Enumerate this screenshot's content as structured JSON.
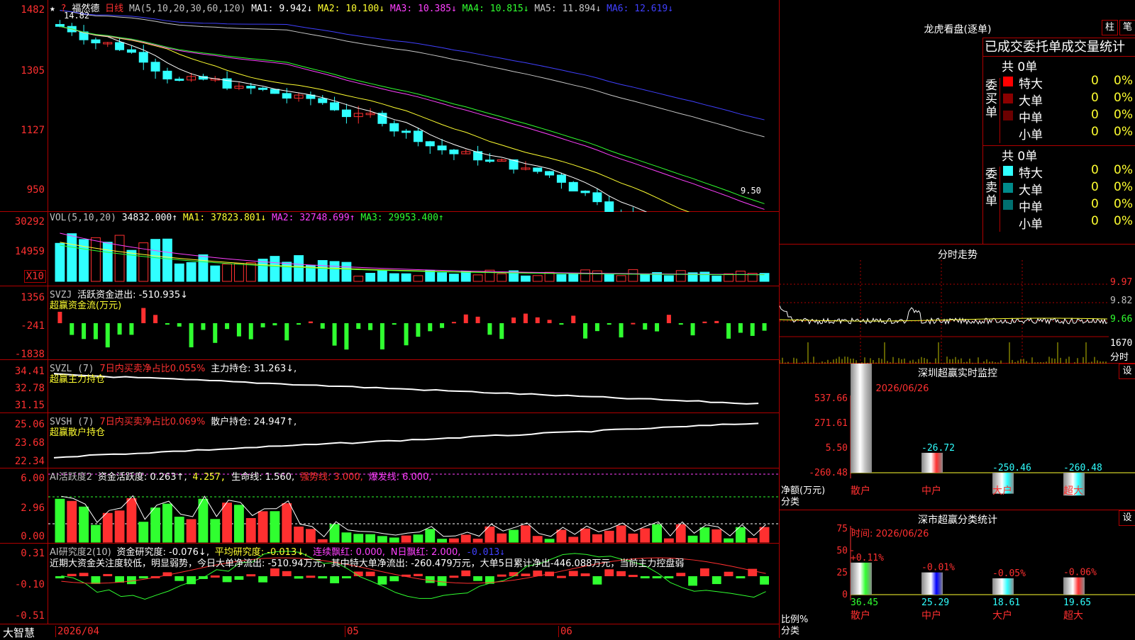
{
  "colors": {
    "up": "#ff3030",
    "down": "#30ffff",
    "grid": "#b00000"
  },
  "main_chart": {
    "stock_name": "福然德",
    "period": "日线",
    "ma_label": "MA(5,10,20,30,60,120)",
    "ma1": "MA1: 9.942↓",
    "ma2": "MA2: 10.100↓",
    "ma3": "MA3: 10.385↓",
    "ma4": "MA4: 10.815↓",
    "ma5": "MA5: 11.894↓",
    "ma6": "MA6: 12.619↓",
    "high_mark": "14.82",
    "low_mark": "9.50",
    "y_ticks": [
      "1482",
      "1305",
      "1127",
      "950"
    ],
    "star": "★",
    "question": "?"
  },
  "volume": {
    "label": "VOL(5,10,20)",
    "value": "34832.000↑",
    "ma1": "MA1: 37823.801↓",
    "ma2": "MA2: 32748.699↑",
    "ma3": "MA3: 29953.400↑",
    "y_ticks": [
      "30292",
      "14959"
    ],
    "unit": "X10"
  },
  "svzj": {
    "label": "SVZJ",
    "title": "活跃资金进出: -510.935↓",
    "subtitle": "超赢资金流(万元)",
    "y_ticks": [
      "1356",
      "-241",
      "-1838"
    ]
  },
  "svzl": {
    "label": "SVZL (7)",
    "ratio": "7日内买卖净占比0.055%",
    "hold": "主力持仓: 31.263↓,",
    "subtitle": "超赢主力持仓",
    "y_ticks": [
      "34.41",
      "32.78",
      "31.15"
    ]
  },
  "svsh": {
    "label": "SVSH (7)",
    "ratio": "7日内买卖净占比0.069%",
    "hold": "散户持仓: 24.947↑,",
    "subtitle": "超赢散户持仓",
    "y_ticks": [
      "25.06",
      "23.68",
      "22.34"
    ]
  },
  "ai_active": {
    "label": "AI活跃度2",
    "v1": "资金活跃度: 0.263↑,",
    "v2": "4.257,",
    "v3": "生命线: 1.560,",
    "v4": "强势线: 3.000,",
    "v5": "爆发线: 6.000,",
    "y_ticks": [
      "6.00",
      "2.96",
      "0.00"
    ]
  },
  "ai_research": {
    "label": "AI研究度2(10)",
    "v1": "资金研究度: -0.076↓,",
    "v2": "平均研究度: -0.013↓,",
    "v3": "连续飘红: 0.000,",
    "v4": "N日飘红: 2.000,",
    "v5": "-0.013↓",
    "comment": "近期大资金关注度较低，明显弱势，今日大单净流出: -510.94万元，其中特大单净流出: -260.479万元，大单5日累计净出-446.088万元，当前主力控盘弱",
    "y_ticks": [
      "0.31",
      "-0.10",
      "-0.51"
    ]
  },
  "bottom": {
    "brand": "大智慧",
    "dates": [
      "2026/04",
      "05",
      "06"
    ]
  },
  "dragon": {
    "title": "龙虎看盘(逐单)",
    "btn_bar": "柱",
    "btn_pen": "笔",
    "tabs": "已成交委托单成交量统计",
    "buy_label": "委买单",
    "sell_label": "委卖单",
    "buy_total": "共 0单",
    "sell_total": "共 0单",
    "rows": [
      {
        "name": "特大",
        "count": "0",
        "pct": "0%"
      },
      {
        "name": "大单",
        "count": "0",
        "pct": "0%"
      },
      {
        "name": "中单",
        "count": "0",
        "pct": "0%"
      },
      {
        "name": "小单",
        "count": "0",
        "pct": "0%"
      }
    ]
  },
  "intraday": {
    "title": "分时走势",
    "prices": [
      "9.97",
      "9.82",
      "9.66"
    ],
    "vol": "1670",
    "vol_label": "分时"
  },
  "sz_monitor": {
    "title": "深圳超赢实时监控",
    "btn": "设",
    "time": "时间: 2026/06/26",
    "y_ticks": [
      "537.66",
      "271.61",
      "5.50",
      "-260.48"
    ],
    "ylabel1": "净额(万元)",
    "ylabel2": "分类",
    "bars": [
      {
        "cat": "散户",
        "value": 537.66,
        "label": "537.66"
      },
      {
        "cat": "中户",
        "value": -26.72,
        "label": "-26.72"
      },
      {
        "cat": "大户",
        "value": -250.46,
        "label": "-250.46"
      },
      {
        "cat": "超大",
        "value": -260.48,
        "label": "-260.48"
      }
    ]
  },
  "sz_class": {
    "title": "深市超赢分类统计",
    "btn": "设",
    "time": "时间: 2026/06/26",
    "y_ticks": [
      "75",
      "50",
      "25",
      "0"
    ],
    "ylabel1": "比例%",
    "ylabel2": "分类",
    "bars": [
      {
        "cat": "散户",
        "value": 36.45,
        "label": "36.45",
        "chg": "+0.11%"
      },
      {
        "cat": "中户",
        "value": 25.29,
        "label": "25.29",
        "chg": "-0.01%"
      },
      {
        "cat": "大户",
        "value": 18.61,
        "label": "18.61",
        "chg": "-0.05%"
      },
      {
        "cat": "超大",
        "value": 19.65,
        "label": "19.65",
        "chg": "-0.06%"
      }
    ]
  }
}
